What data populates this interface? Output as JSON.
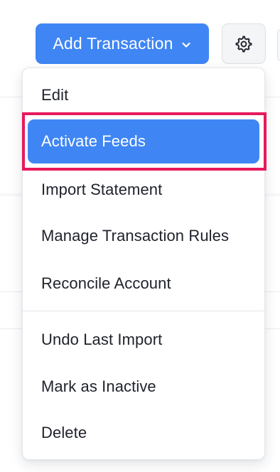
{
  "toolbar": {
    "add_transaction_label": "Add Transaction",
    "add_transaction_icon": "chevron-down-icon",
    "settings_icon": "gear-icon"
  },
  "menu": {
    "items": [
      {
        "label": "Edit",
        "active": false
      },
      {
        "label": "Activate Feeds",
        "active": true
      },
      {
        "label": "Import Statement",
        "active": false
      },
      {
        "label": "Manage Transaction Rules",
        "active": false
      },
      {
        "label": "Reconcile Account",
        "active": false
      },
      {
        "label": "Undo Last Import",
        "active": false
      },
      {
        "label": "Mark as Inactive",
        "active": false
      },
      {
        "label": "Delete",
        "active": false
      }
    ]
  },
  "colors": {
    "accent": "#3f86f4",
    "highlight_outline": "#e8195c",
    "menu_text": "#21232c"
  }
}
